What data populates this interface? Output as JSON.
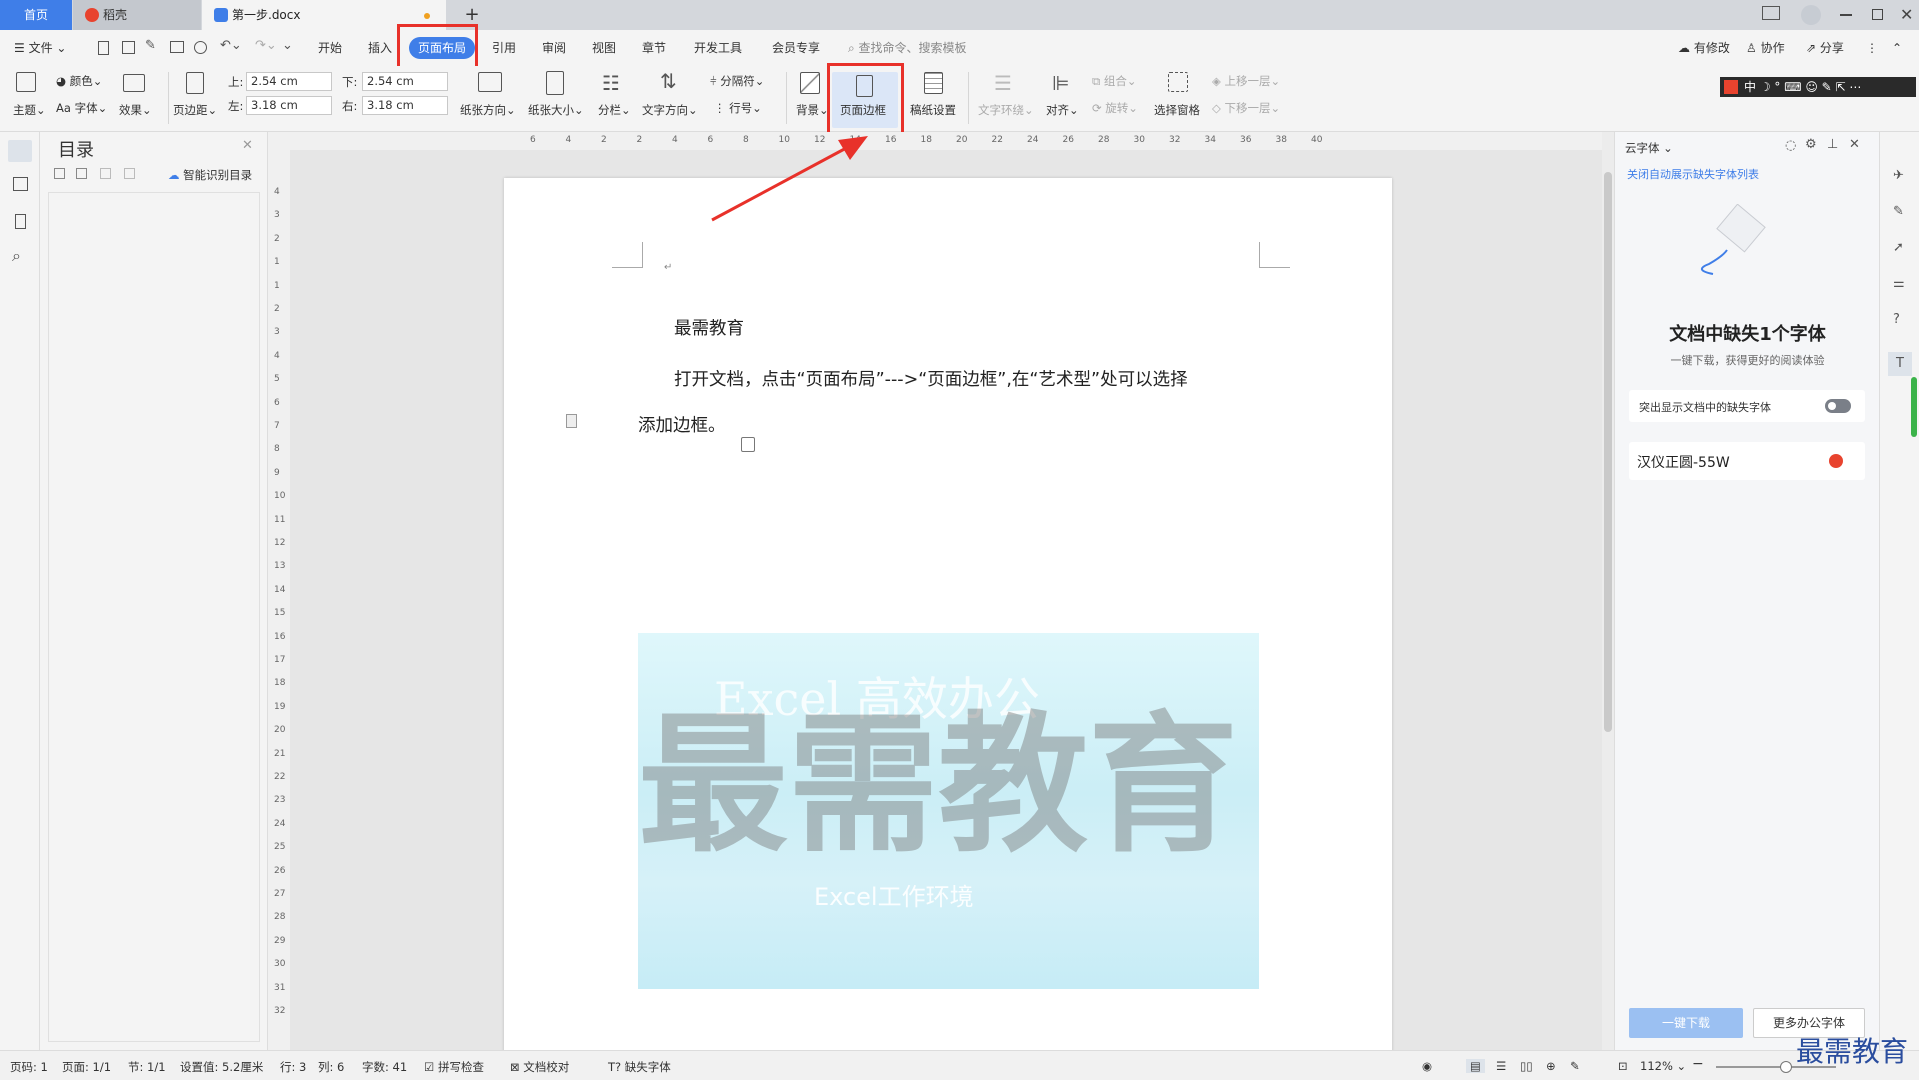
{
  "tabs": {
    "home": "首页",
    "daoke": "稻壳",
    "doc": "第一步.docx"
  },
  "ribbon_tabs": [
    "文件",
    "开始",
    "插入",
    "页面布局",
    "引用",
    "审阅",
    "视图",
    "章节",
    "开发工具",
    "会员专享"
  ],
  "search_placeholder": "查找命令、搜索模板",
  "right_actions": {
    "modified": "有修改",
    "collab": "协作",
    "share": "分享"
  },
  "toolbar": {
    "theme": "主题",
    "color": "颜色",
    "font": "字体",
    "effect": "效果",
    "margins": "页边距",
    "top_label": "上:",
    "top_value": "2.54 cm",
    "bottom_label": "下:",
    "bottom_value": "2.54 cm",
    "left_label": "左:",
    "left_value": "3.18 cm",
    "right_label": "右:",
    "right_value": "3.18 cm",
    "orientation": "纸张方向",
    "size": "纸张大小",
    "columns": "分栏",
    "text_direction": "文字方向",
    "separator": "分隔符",
    "line_number": "行号",
    "background": "背景",
    "page_border": "页面边框",
    "draft": "稿纸设置",
    "wrap": "文字环绕",
    "align": "对齐",
    "group": "组合",
    "rotate": "旋转",
    "select_pane": "选择窗格",
    "bring_forward": "上移一层",
    "send_backward": "下移一层"
  },
  "ime_bar": "中",
  "nav": {
    "title": "目录",
    "smart": "智能识别目录"
  },
  "ruler_h": [
    "6",
    "4",
    "2",
    "2",
    "4",
    "6",
    "8",
    "10",
    "12",
    "14",
    "16",
    "18",
    "20",
    "22",
    "24",
    "26",
    "28",
    "30",
    "32",
    "34",
    "36",
    "38",
    "40"
  ],
  "ruler_v": [
    "4",
    "3",
    "2",
    "1",
    "1",
    "2",
    "3",
    "4",
    "5",
    "6",
    "7",
    "8",
    "9",
    "10",
    "11",
    "12",
    "13",
    "14",
    "15",
    "16",
    "17",
    "18",
    "19",
    "20",
    "21",
    "22",
    "23",
    "24",
    "25",
    "26",
    "27",
    "28",
    "29",
    "30",
    "31",
    "32"
  ],
  "document": {
    "heading": "最需教育",
    "para1": "打开文档，点击“页面布局”--->“页面边框”,在“艺术型”处可以选择",
    "para2": "添加边框。",
    "image_watermark": "最需教育",
    "image_text1": "Excel 高效办公",
    "image_text2": "Excel工作环境"
  },
  "right_panel": {
    "title": "云字体",
    "close_auto": "关闭自动展示缺失字体列表",
    "heading": "文档中缺失1个字体",
    "sub": "一键下载，获得更好的阅读体验",
    "toggle_label": "突出显示文档中的缺失字体",
    "font_name": "汉仪正圆-55W",
    "download": "一键下载",
    "more": "更多办公字体"
  },
  "status": {
    "page": "页码: 1",
    "pages": "页面: 1/1",
    "section": "节: 1/1",
    "setting": "设置值: 5.2厘米",
    "row": "行: 3",
    "col": "列: 6",
    "words": "字数: 41",
    "spell": "拼写检查",
    "proof": "文档校对",
    "missing_font": "缺失字体",
    "zoom": "112%"
  },
  "corner_watermark": "最需教育",
  "colors": {
    "accent": "#3f7ee8",
    "annotation_red": "#e8312a",
    "download_btn": "#9bc0f2"
  }
}
